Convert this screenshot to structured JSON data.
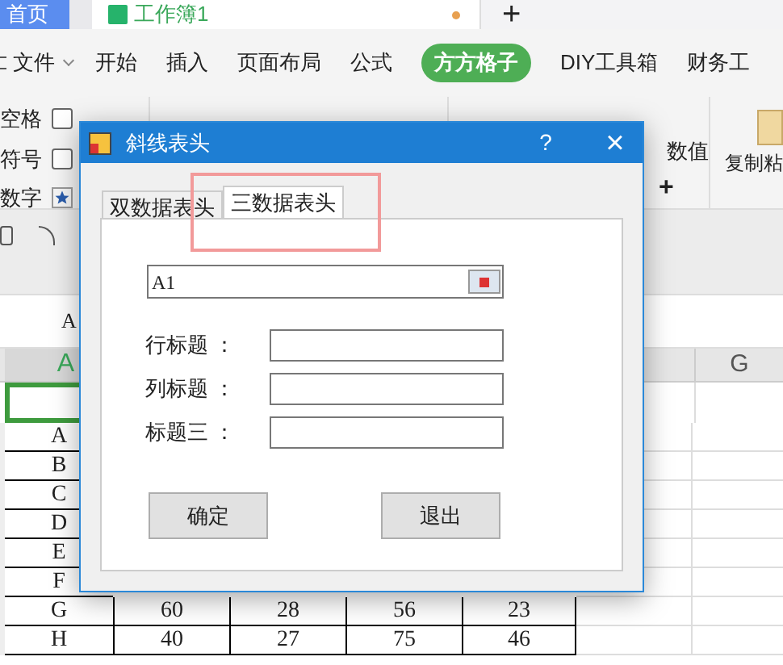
{
  "top_tabs": [
    {
      "label": "首页",
      "kind": "home",
      "selected": false
    },
    {
      "label": "工作簿1",
      "kind": "doc",
      "selected": true
    },
    {
      "label": "+",
      "kind": "new",
      "selected": false
    }
  ],
  "menu": {
    "file": "文件",
    "items": [
      {
        "label": "开始",
        "selected": false
      },
      {
        "label": "插入",
        "selected": false
      },
      {
        "label": "页面布局",
        "selected": false
      },
      {
        "label": "公式",
        "selected": false
      },
      {
        "label": "方方格子",
        "selected": true
      },
      {
        "label": "DIY工具箱",
        "selected": false
      },
      {
        "label": "财务工",
        "selected": false
      }
    ]
  },
  "ribbon": {
    "left": [
      {
        "label": "空格",
        "checked": false
      },
      {
        "label": "符号",
        "checked": false
      },
      {
        "label": "数字"
      }
    ],
    "value": "数值",
    "plus": "+",
    "paste": "复制粘"
  },
  "name_box": "A",
  "columns": [
    {
      "label": "A",
      "selected": true
    },
    {
      "label": "G",
      "selected": false
    }
  ],
  "rows": [
    {
      "label": "A",
      "values": []
    },
    {
      "label": "B",
      "values": []
    },
    {
      "label": "C",
      "values": []
    },
    {
      "label": "D",
      "values": []
    },
    {
      "label": "E",
      "values": []
    },
    {
      "label": "F",
      "values": []
    },
    {
      "label": "G",
      "values": [
        "60",
        "28",
        "56",
        "23"
      ]
    },
    {
      "label": "H",
      "values": [
        "40",
        "27",
        "75",
        "46"
      ]
    }
  ],
  "dialog": {
    "title": "斜线表头",
    "help": "?",
    "close": "×",
    "tabs": [
      {
        "label": "双数据表头",
        "selected": false
      },
      {
        "label": "三数据表头",
        "selected": true
      }
    ],
    "range": "A1",
    "fields": [
      {
        "label": "行标题 ："
      },
      {
        "label": "列标题 ："
      },
      {
        "label": "标题三 ："
      }
    ],
    "buttons": [
      "确定",
      "退出"
    ]
  }
}
